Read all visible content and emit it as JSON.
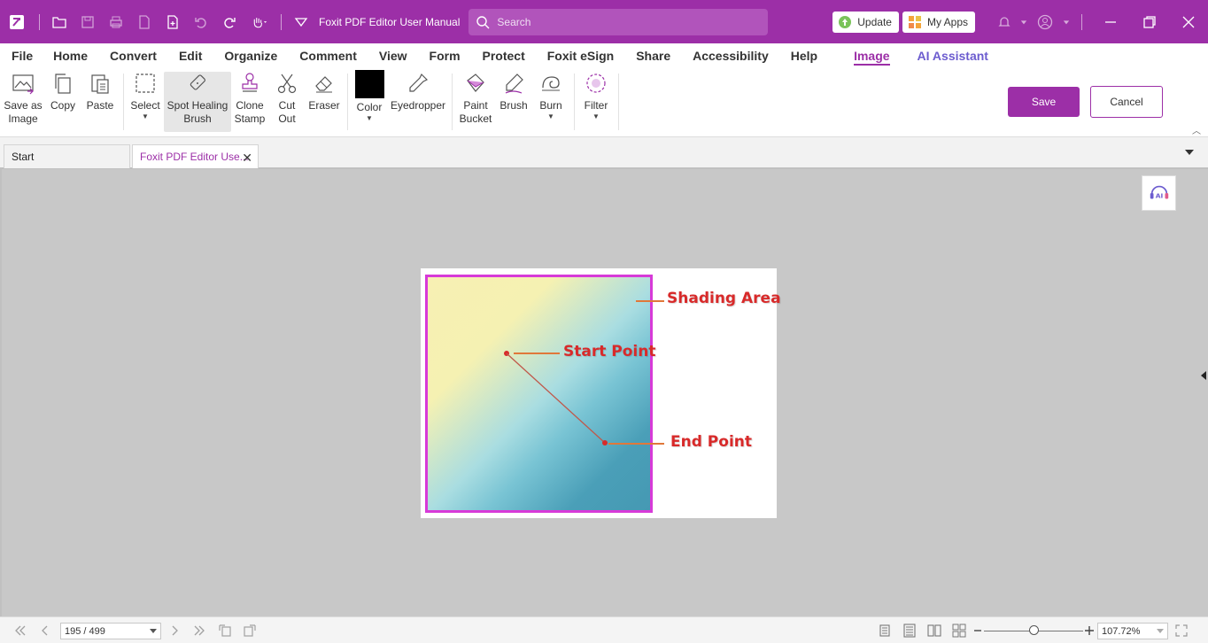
{
  "titlebar": {
    "doc_title": "Foxit PDF Editor User Manual",
    "search_placeholder": "Search",
    "update_label": "Update",
    "myapps_label": "My Apps",
    "icons": [
      "foxit-logo-icon",
      "open-folder-icon",
      "save-icon",
      "print-icon",
      "export-icon",
      "new-icon",
      "undo-icon",
      "redo-icon",
      "hand-tool-icon",
      "customize-quick-access-icon",
      "bell-icon",
      "user-icon",
      "minimize-icon",
      "restore-icon",
      "close-icon"
    ]
  },
  "menu": {
    "items": [
      "File",
      "Home",
      "Convert",
      "Edit",
      "Organize",
      "Comment",
      "View",
      "Form",
      "Protect",
      "Foxit eSign",
      "Share",
      "Accessibility",
      "Help",
      "Image",
      "AI Assistant"
    ],
    "active": "Image"
  },
  "ribbon": {
    "save_as_image": [
      "Save as",
      "Image"
    ],
    "copy": "Copy",
    "paste": "Paste",
    "select": "Select",
    "spot_healing": [
      "Spot Healing",
      "Brush"
    ],
    "clone_stamp": [
      "Clone",
      "Stamp"
    ],
    "cut_out": [
      "Cut",
      "Out"
    ],
    "eraser": "Eraser",
    "color": "Color",
    "color_value": "#000000",
    "eyedropper": "Eyedropper",
    "paint_bucket": [
      "Paint",
      "Bucket"
    ],
    "brush": "Brush",
    "burn": "Burn",
    "filter": "Filter",
    "save_label": "Save",
    "cancel_label": "Cancel"
  },
  "tabs": [
    {
      "label": "Start"
    },
    {
      "label": "Foxit PDF Editor Use..."
    }
  ],
  "figure": {
    "shading_area": "Shading Area",
    "start_point": "Start Point",
    "end_point": "End Point"
  },
  "statusbar": {
    "page_value": "195 / 499",
    "zoom_value": "107.72%",
    "zoom_level": 0.5
  },
  "colors": {
    "brand": "#9c2fa7",
    "ai_accent": "#6c5ccf",
    "shading_border": "#d73ad8",
    "callout_text": "#d82a2a"
  }
}
